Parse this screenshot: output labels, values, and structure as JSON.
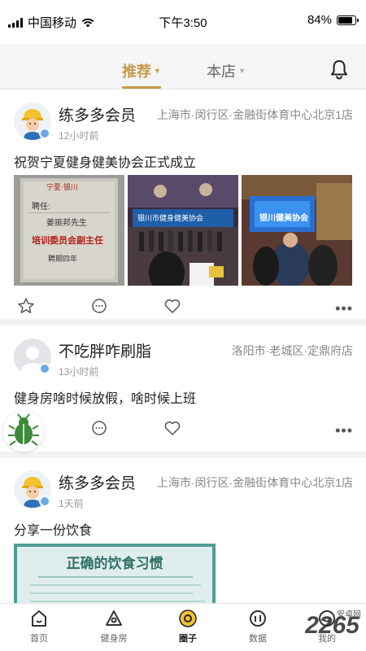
{
  "status_bar": {
    "carrier": "中国移动",
    "time": "下午3:50",
    "battery": "84%",
    "battery_level": 0.84
  },
  "header": {
    "tabs": [
      {
        "label": "推荐",
        "active": true
      },
      {
        "label": "本店",
        "active": false
      }
    ],
    "icons": [
      "bell-icon"
    ]
  },
  "posts": [
    {
      "username": "练多多会员",
      "location": "上海市·闵行区·金融街体育中心北京1店",
      "time": "12小时前",
      "text": "祝贺宁夏健身健美协会正式成立",
      "images": [
        {
          "kind": "certificate",
          "lines": [
            "宁夏·银川",
            "聘任:",
            "姜振邦先生",
            "培训委员会副主任",
            "聘期四年"
          ]
        },
        {
          "kind": "event-stage",
          "lines": [
            "银川市健身健美协会"
          ]
        },
        {
          "kind": "event-screen",
          "lines": [
            "银川健美协会"
          ]
        }
      ]
    },
    {
      "username": "不吃胖咋刷脂",
      "location": "洛阳市·老城区·定鼎府店",
      "time": "13小时前",
      "text": "健身房啥时候放假，啥时候上班"
    },
    {
      "username": "练多多会员",
      "location": "上海市·闵行区·金融街体育中心北京1店",
      "time": "1天前",
      "text": "分享一份饮食",
      "images": [
        {
          "kind": "diet-poster",
          "title": "正确的饮食习惯"
        }
      ]
    }
  ],
  "bottom_nav": [
    {
      "label": "首页",
      "icon": "home-icon",
      "active": false
    },
    {
      "label": "健身房",
      "icon": "gym-icon",
      "active": false
    },
    {
      "label": "圈子",
      "icon": "circle-icon",
      "active": true
    },
    {
      "label": "数据",
      "icon": "data-icon",
      "active": false
    },
    {
      "label": "我的",
      "icon": "profile-icon",
      "active": false
    }
  ],
  "watermark": {
    "text": "2265",
    "subtext": "安卓网"
  },
  "colors": {
    "accent": "#c49a4a",
    "badge": "#6aa8e8",
    "beetle": "#3d8a3a",
    "poster": "#4f9c95"
  }
}
